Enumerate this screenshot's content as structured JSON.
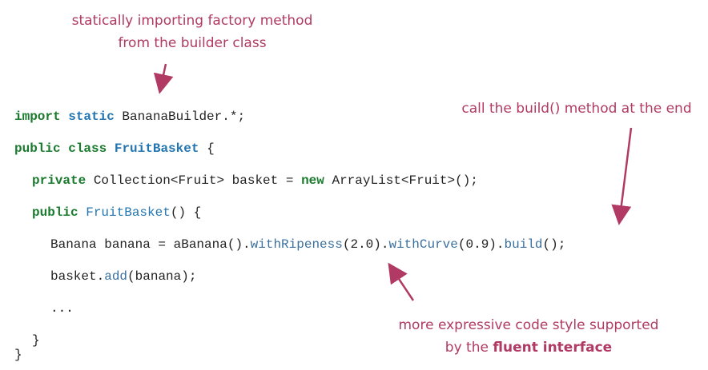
{
  "annotations": {
    "static_import": {
      "line1": "statically importing factory method",
      "line2": "from the builder class"
    },
    "build_call": {
      "text": "call the build() method at the end"
    },
    "fluent": {
      "line1": "more expressive code style supported",
      "line2_prefix": "by the ",
      "line2_bold": "fluent interface"
    }
  },
  "code": {
    "line1": {
      "kw1": "import",
      "kw2": "static",
      "rest": " BananaBuilder.*;"
    },
    "line2": {
      "kw1": "public",
      "kw2": "class",
      "name": "FruitBasket",
      "rest": " {"
    },
    "line3": {
      "kw": "private",
      "type": " Collection<Fruit>",
      "var": " basket = ",
      "kw_new": "new",
      "rest": " ArrayList<Fruit>();"
    },
    "line4": {
      "kw": "public",
      "name": "FruitBasket",
      "rest": "() {"
    },
    "line5": {
      "start": "Banana banana = aBanana().",
      "m1": "withRipeness",
      "a1": "(2.0).",
      "m2": "withCurve",
      "a2": "(0.9).",
      "m3": "build",
      "end": "();"
    },
    "line6": {
      "start": "basket.",
      "m": "add",
      "end": "(banana);"
    },
    "line7": {
      "text": "..."
    },
    "line8": {
      "text": "}"
    },
    "line9": {
      "text": "}"
    }
  },
  "colors": {
    "annotation": "#b03a63",
    "keyword": "#1a7a2e",
    "class_keyword": "#2275b0"
  }
}
